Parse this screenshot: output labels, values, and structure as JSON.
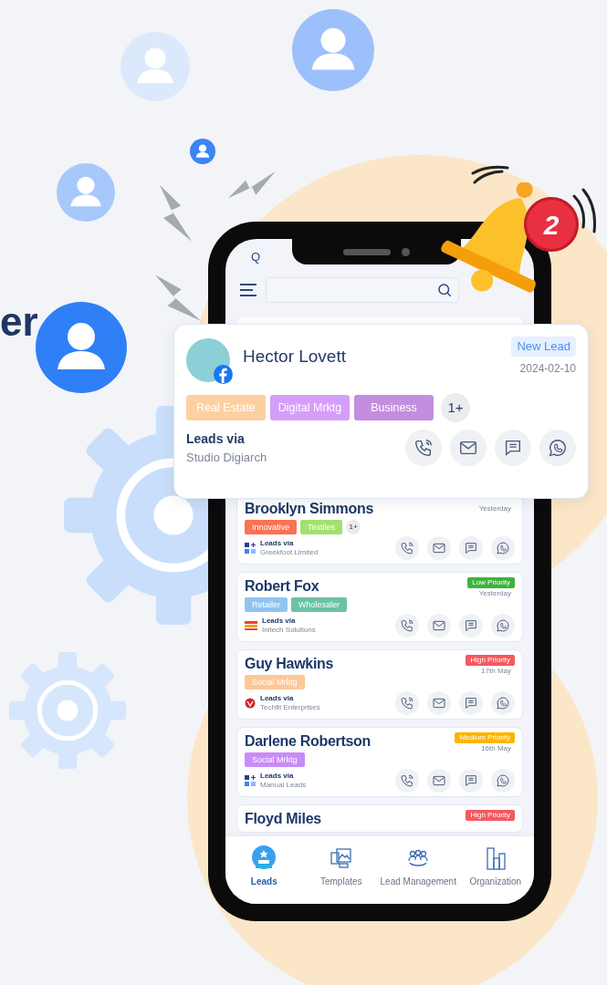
{
  "side_text": "er",
  "status_bar": {
    "glyph": "Q"
  },
  "notification": {
    "count": "2"
  },
  "popup": {
    "name": "Hector Lovett",
    "status": "New Lead",
    "date": "2024-02-10",
    "tags": [
      {
        "label": "Real Estate",
        "color": "#fdd0a2"
      },
      {
        "label": "Digital Mrktg",
        "color": "#d69ef9"
      },
      {
        "label": "Business",
        "color": "#c38edf"
      }
    ],
    "more": "1+",
    "source_label": "Leads via",
    "source": "Studio Digiarch"
  },
  "leads": [
    {
      "name": "Brooklyn Simmons",
      "date": "Yesterday",
      "tags": [
        {
          "label": "Innovative",
          "color": "#fb7254"
        },
        {
          "label": "Textiles",
          "color": "#a3e06f"
        }
      ],
      "more": "1+",
      "source_label": "Leads via",
      "source": "Greekfoot Limited",
      "kind": "squares"
    },
    {
      "name": "Robert Fox",
      "priority": {
        "label": "Low Priority",
        "color": "#3fb13f"
      },
      "date": "Yesterday",
      "tags": [
        {
          "label": "Retailer",
          "color": "#90c4f0"
        },
        {
          "label": "Wholesaler",
          "color": "#6cc2a4"
        }
      ],
      "source_label": "Leads via",
      "source": "Initech Solutions",
      "kind": "stripes"
    },
    {
      "name": "Guy Hawkins",
      "priority": {
        "label": "High Priority",
        "color": "#f4595e"
      },
      "date": "17th May",
      "tags": [
        {
          "label": "Social Mrktg",
          "color": "#fdc896"
        }
      ],
      "source_label": "Leads via",
      "source": "Techfit Enterprises",
      "kind": "emblem"
    },
    {
      "name": "Darlene Robertson",
      "priority": {
        "label": "Medium Priority",
        "color": "#fdb500"
      },
      "date": "16th May",
      "tags": [
        {
          "label": "Social Mrktg",
          "color": "#c88cf7"
        }
      ],
      "source_label": "Leads via",
      "source": "Manual Leads",
      "kind": "squares"
    },
    {
      "name": "Floyd Miles",
      "priority": {
        "label": "High Priority",
        "color": "#f4595e"
      }
    }
  ],
  "nav": [
    {
      "label": "Leads",
      "selected": true,
      "kind": "trophy"
    },
    {
      "label": "Templates",
      "selected": false,
      "kind": "templates"
    },
    {
      "label": "Lead Management",
      "selected": false,
      "kind": "team"
    },
    {
      "label": "Organization",
      "selected": false,
      "kind": "buildings"
    }
  ]
}
